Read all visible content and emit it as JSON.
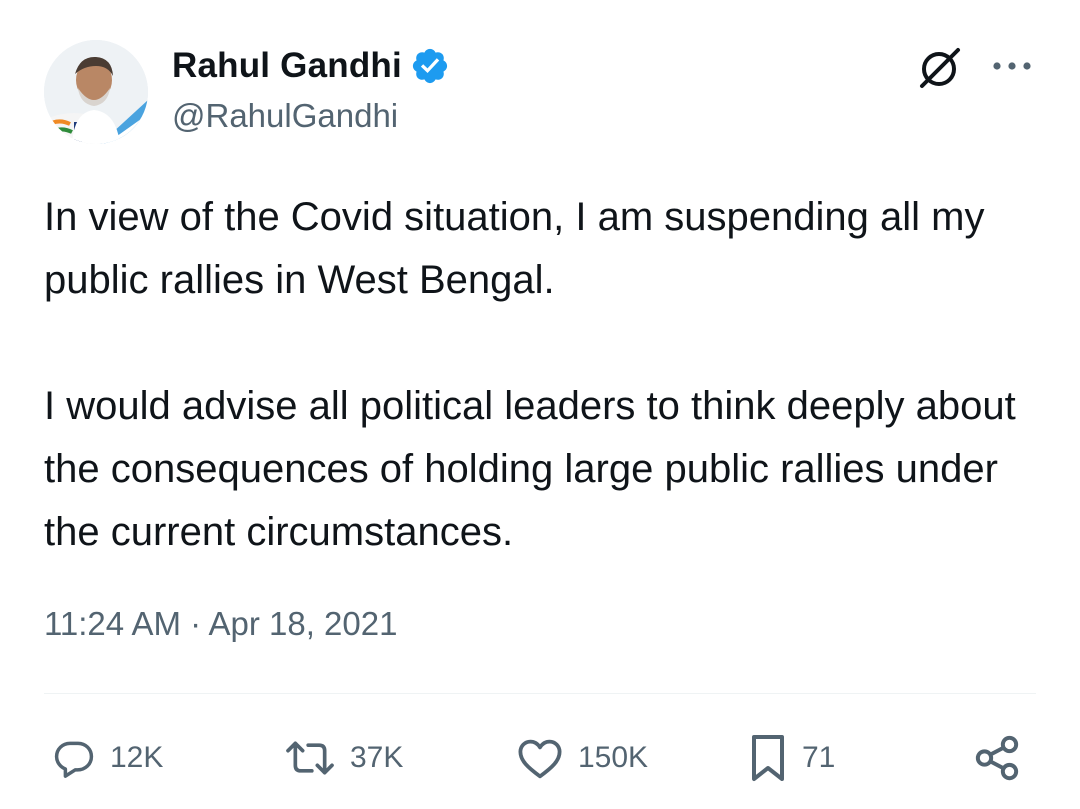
{
  "author": {
    "display_name": "Rahul Gandhi",
    "handle": "@RahulGandhi",
    "verified": true,
    "verified_badge_color": "#1d9bf0"
  },
  "tweet": {
    "paragraphs": [
      "In view of the Covid situation, I am suspending all my public rallies in West Bengal.",
      "I would advise all political leaders to think deeply about the consequences of holding large public rallies under the current circumstances."
    ],
    "timestamp": "11:24 AM · Apr 18, 2021"
  },
  "actions": {
    "reply": {
      "icon": "reply-icon",
      "count": "12K"
    },
    "retweet": {
      "icon": "retweet-icon",
      "count": "37K"
    },
    "like": {
      "icon": "heart-icon",
      "count": "150K"
    },
    "bookmark": {
      "icon": "bookmark-icon",
      "count": "71"
    },
    "share": {
      "icon": "share-icon"
    }
  },
  "header_icons": {
    "grok": "grok-icon",
    "more": "more-icon"
  },
  "colors": {
    "text_primary": "#0f1419",
    "text_secondary": "#536471",
    "divider": "#eff3f4"
  }
}
